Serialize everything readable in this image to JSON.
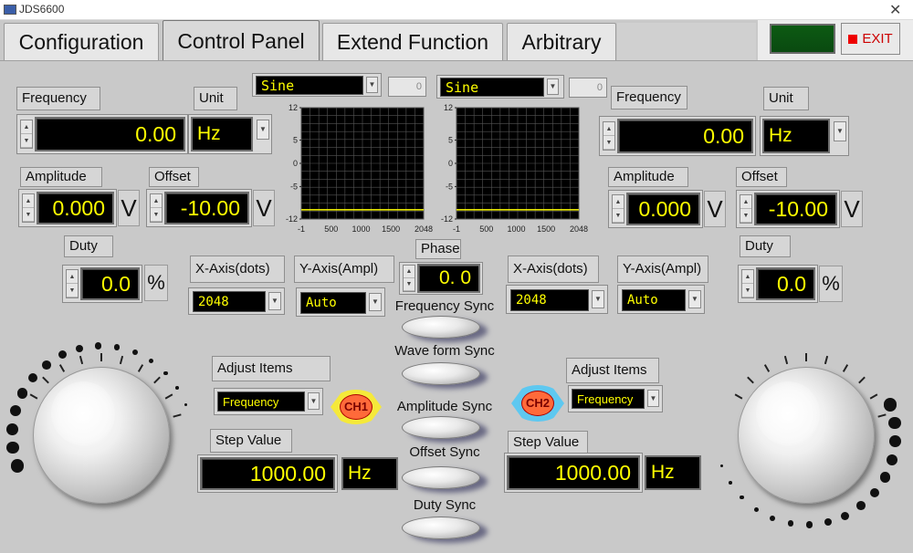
{
  "window": {
    "title": "JDS6600",
    "close_glyph": "✕"
  },
  "tabs": [
    {
      "label": "Configuration"
    },
    {
      "label": "Control Panel"
    },
    {
      "label": "Extend Function"
    },
    {
      "label": "Arbitrary"
    }
  ],
  "exit_label": "EXIT",
  "ch1": {
    "frequency_label": "Frequency",
    "frequency_value": "0.00",
    "unit_label": "Unit",
    "unit_value": "Hz",
    "amplitude_label": "Amplitude",
    "amplitude_value": "0.000",
    "amplitude_unit": "V",
    "offset_label": "Offset",
    "offset_value": "-10.00",
    "offset_unit": "V",
    "duty_label": "Duty",
    "duty_value": "0.0",
    "duty_unit": "%",
    "waveform": "Sine",
    "wave_index": "0",
    "xaxis_label": "X-Axis(dots)",
    "xaxis_value": "2048",
    "yaxis_label": "Y-Axis(Ampl)",
    "yaxis_value": "Auto",
    "adjust_label": "Adjust Items",
    "adjust_value": "Frequency",
    "step_label": "Step Value",
    "step_value": "1000.00",
    "step_unit": "Hz",
    "badge": "CH1",
    "badge_color": "#f5e93a"
  },
  "ch2": {
    "frequency_label": "Frequency",
    "frequency_value": "0.00",
    "unit_label": "Unit",
    "unit_value": "Hz",
    "amplitude_label": "Amplitude",
    "amplitude_value": "0.000",
    "amplitude_unit": "V",
    "offset_label": "Offset",
    "offset_value": "-10.00",
    "offset_unit": "V",
    "duty_label": "Duty",
    "duty_value": "0.0",
    "duty_unit": "%",
    "waveform": "Sine",
    "wave_index": "0",
    "xaxis_label": "X-Axis(dots)",
    "xaxis_value": "2048",
    "yaxis_label": "Y-Axis(Ampl)",
    "yaxis_value": "Auto",
    "adjust_label": "Adjust Items",
    "adjust_value": "Frequency",
    "step_label": "Step Value",
    "step_value": "1000.00",
    "step_unit": "Hz",
    "badge": "CH2",
    "badge_color": "#5ec8f0"
  },
  "phase": {
    "label": "Phase",
    "value": "0. 0"
  },
  "sync": {
    "frequency": "Frequency Sync",
    "waveform": "Wave form Sync",
    "amplitude": "Amplitude Sync",
    "offset": "Offset Sync",
    "duty": "Duty  Sync"
  },
  "chart_data": [
    {
      "type": "line",
      "x_ticks": [
        "-1",
        "500",
        "1000",
        "1500",
        "2048"
      ],
      "y_ticks": [
        "12",
        "5",
        "0",
        "-5",
        "-12"
      ],
      "xlim": [
        -1,
        2048
      ],
      "ylim": [
        -12,
        12
      ],
      "grid": true,
      "trace_color": "#ffff00",
      "x": [
        -1,
        2048
      ],
      "y": [
        -10,
        -10
      ]
    },
    {
      "type": "line",
      "x_ticks": [
        "-1",
        "500",
        "1000",
        "1500",
        "2048"
      ],
      "y_ticks": [
        "12",
        "5",
        "0",
        "-5",
        "-12"
      ],
      "xlim": [
        -1,
        2048
      ],
      "ylim": [
        -12,
        12
      ],
      "grid": true,
      "trace_color": "#ffff00",
      "x": [
        -1,
        2048
      ],
      "y": [
        -10,
        -10
      ]
    }
  ]
}
